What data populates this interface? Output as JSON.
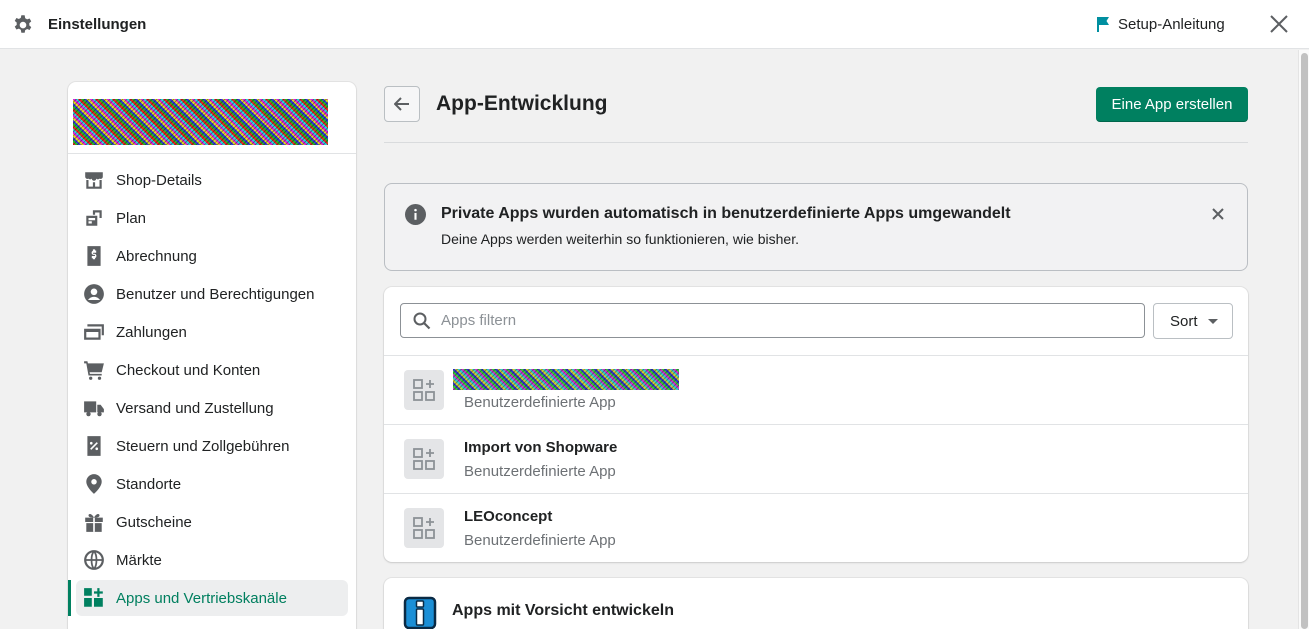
{
  "topbar": {
    "title": "Einstellungen",
    "setup_label": "Setup-Anleitung",
    "icons": {
      "settings": "gear-icon",
      "setup": "flag-icon",
      "close": "close-icon"
    }
  },
  "sidebar": {
    "items": [
      {
        "label": "Shop-Details",
        "icon": "store-icon"
      },
      {
        "label": "Plan",
        "icon": "plan-icon"
      },
      {
        "label": "Abrechnung",
        "icon": "billing-icon"
      },
      {
        "label": "Benutzer und Berechtigungen",
        "icon": "user-icon"
      },
      {
        "label": "Zahlungen",
        "icon": "payments-icon"
      },
      {
        "label": "Checkout und Konten",
        "icon": "cart-icon"
      },
      {
        "label": "Versand und Zustellung",
        "icon": "truck-icon"
      },
      {
        "label": "Steuern und Zollgebühren",
        "icon": "tax-icon"
      },
      {
        "label": "Standorte",
        "icon": "location-icon"
      },
      {
        "label": "Gutscheine",
        "icon": "gift-icon"
      },
      {
        "label": "Märkte",
        "icon": "globe-icon"
      },
      {
        "label": "Apps und Vertriebskanäle",
        "icon": "apps-icon",
        "active": true
      }
    ]
  },
  "header": {
    "title": "App-Entwicklung",
    "create_button": "Eine App erstellen"
  },
  "banner": {
    "title": "Private Apps wurden automatisch in benutzerdefinierte Apps umgewandelt",
    "text": "Deine Apps werden weiterhin so funktionieren, wie bisher."
  },
  "apps": {
    "search_placeholder": "Apps filtern",
    "search_value": "",
    "sort_label": "Sort",
    "list": [
      {
        "name": "",
        "type": "Benutzerdefinierte App",
        "redacted": true
      },
      {
        "name": "Import von Shopware",
        "type": "Benutzerdefinierte App"
      },
      {
        "name": "LEOconcept",
        "type": "Benutzerdefinierte App"
      }
    ]
  },
  "caution": {
    "title": "Apps mit Vorsicht entwickeln"
  },
  "colors": {
    "primary": "#008060",
    "active_text": "#007f5f",
    "setup_flag": "#008fa0"
  }
}
